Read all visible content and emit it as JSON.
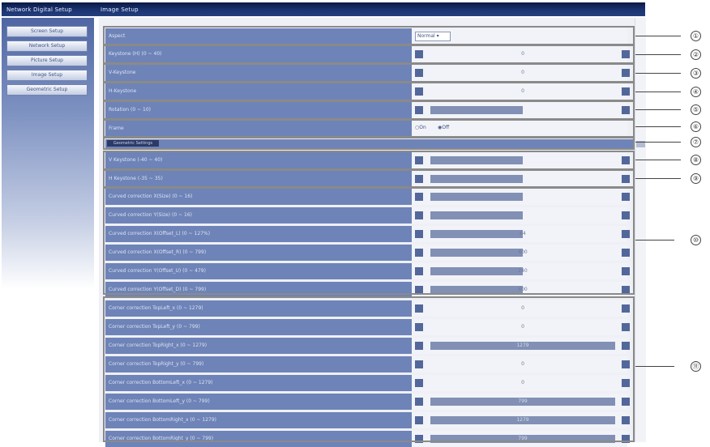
{
  "header": {
    "title": "Network Digital Setup",
    "subtitle": "Image Setup"
  },
  "sidebar": {
    "items": [
      {
        "label": "Screen Setup"
      },
      {
        "label": "Network Setup"
      },
      {
        "label": "Picture Setup"
      },
      {
        "label": "Image Setup"
      },
      {
        "label": "Geometric Setup"
      }
    ]
  },
  "geometry_tab": "Geometric Settings",
  "settings": [
    {
      "label": "Aspect",
      "type": "select",
      "value": "Normal"
    },
    {
      "label": "Keystone (H) (0 ~ 40)",
      "type": "slider",
      "value": "0",
      "fill": 0
    },
    {
      "label": "V-Keystone",
      "type": "slider",
      "value": "0",
      "fill": 0
    },
    {
      "label": "H-Keystone",
      "type": "slider",
      "value": "0",
      "fill": 0
    },
    {
      "label": "Rotation (0 ~ 10)",
      "type": "slider",
      "value": "",
      "fill": 0.5
    },
    {
      "label": "Frame",
      "type": "radio",
      "options": [
        "On",
        "Off"
      ],
      "selected": "Off"
    },
    {
      "label": "V Keystone (-40 ~ 40)",
      "type": "slider",
      "value": "",
      "fill": 0.5
    },
    {
      "label": "H Keystone (-35 ~ 35)",
      "type": "slider",
      "value": "",
      "fill": 0.5
    },
    {
      "label": "Curved correction X(Size) (0 ~ 16)",
      "type": "slider",
      "value": "",
      "fill": 0.5
    },
    {
      "label": "Curved correction Y(Size) (0 ~ 16)",
      "type": "slider",
      "value": "",
      "fill": 0.5
    },
    {
      "label": "Curved correction X(Offset_L) (0 ~ 127%)",
      "type": "slider",
      "value": "64",
      "fill": 0.5
    },
    {
      "label": "Curved correction X(Offset_R) (0 ~ 799)",
      "type": "slider",
      "value": "400",
      "fill": 0.5
    },
    {
      "label": "Curved correction Y(Offset_U) (0 ~ 479)",
      "type": "slider",
      "value": "240",
      "fill": 0.5
    },
    {
      "label": "Curved correction Y(Offset_D) (0 ~ 799)",
      "type": "slider",
      "value": "400",
      "fill": 0.5
    },
    {
      "label": "Corner correction TopLeft_x (0 ~ 1279)",
      "type": "slider",
      "value": "0",
      "fill": 0
    },
    {
      "label": "Corner correction TopLeft_y (0 ~ 799)",
      "type": "slider",
      "value": "0",
      "fill": 0
    },
    {
      "label": "Corner correction TopRight_x (0 ~ 1279)",
      "type": "slider",
      "value": "1279",
      "fill": 1
    },
    {
      "label": "Corner correction TopRight_y (0 ~ 799)",
      "type": "slider",
      "value": "0",
      "fill": 0
    },
    {
      "label": "Corner correction BottomLeft_x (0 ~ 1279)",
      "type": "slider",
      "value": "0",
      "fill": 0
    },
    {
      "label": "Corner correction BottomLeft_y (0 ~ 799)",
      "type": "slider",
      "value": "799",
      "fill": 1
    },
    {
      "label": "Corner correction BottomRight_x (0 ~ 1279)",
      "type": "slider",
      "value": "1279",
      "fill": 1
    },
    {
      "label": "Corner correction BottomRight_y (0 ~ 799)",
      "type": "slider",
      "value": "799",
      "fill": 1
    }
  ],
  "callouts": [
    "①",
    "②",
    "③",
    "④",
    "⑤",
    "⑥",
    "⑦",
    "⑧",
    "⑨",
    "⑩",
    "⑪"
  ]
}
